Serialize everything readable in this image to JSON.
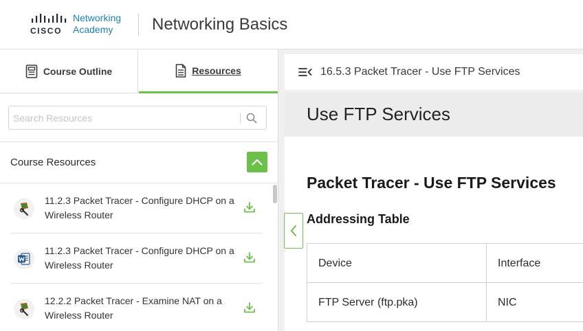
{
  "header": {
    "logo_brand": "CISCO",
    "logo_line1": "Networking",
    "logo_line2": "Academy",
    "course_title": "Networking Basics"
  },
  "left_panel": {
    "tabs": [
      {
        "label": "Course Outline",
        "icon": "outline-icon",
        "active": false
      },
      {
        "label": "Resources",
        "icon": "document-icon",
        "active": true
      }
    ],
    "search": {
      "placeholder": "Search Resources",
      "value": ""
    },
    "section_title": "Course Resources",
    "resources": [
      {
        "title": "11.2.3 Packet Tracer - Configure DHCP on a Wireless Router",
        "icon": "packet-tracer-icon"
      },
      {
        "title": "11.2.3 Packet Tracer - Configure DHCP on a Wireless Router",
        "icon": "word-doc-icon"
      },
      {
        "title": "12.2.2 Packet Tracer - Examine NAT on a Wireless Router",
        "icon": "packet-tracer-icon"
      }
    ]
  },
  "content": {
    "breadcrumb": "16.5.3 Packet Tracer - Use FTP Services",
    "page_title": "Use FTP Services",
    "doc_title": "Packet Tracer - Use FTP Services",
    "doc_subtitle": "Addressing Table",
    "table": {
      "headers": [
        "Device",
        "Interface"
      ],
      "rows": [
        [
          "FTP Server (ftp.pka)",
          "NIC"
        ]
      ]
    }
  },
  "colors": {
    "accent_green": "#6cc04a",
    "cisco_blue": "#1b7fbd",
    "word_blue": "#2b579a"
  }
}
